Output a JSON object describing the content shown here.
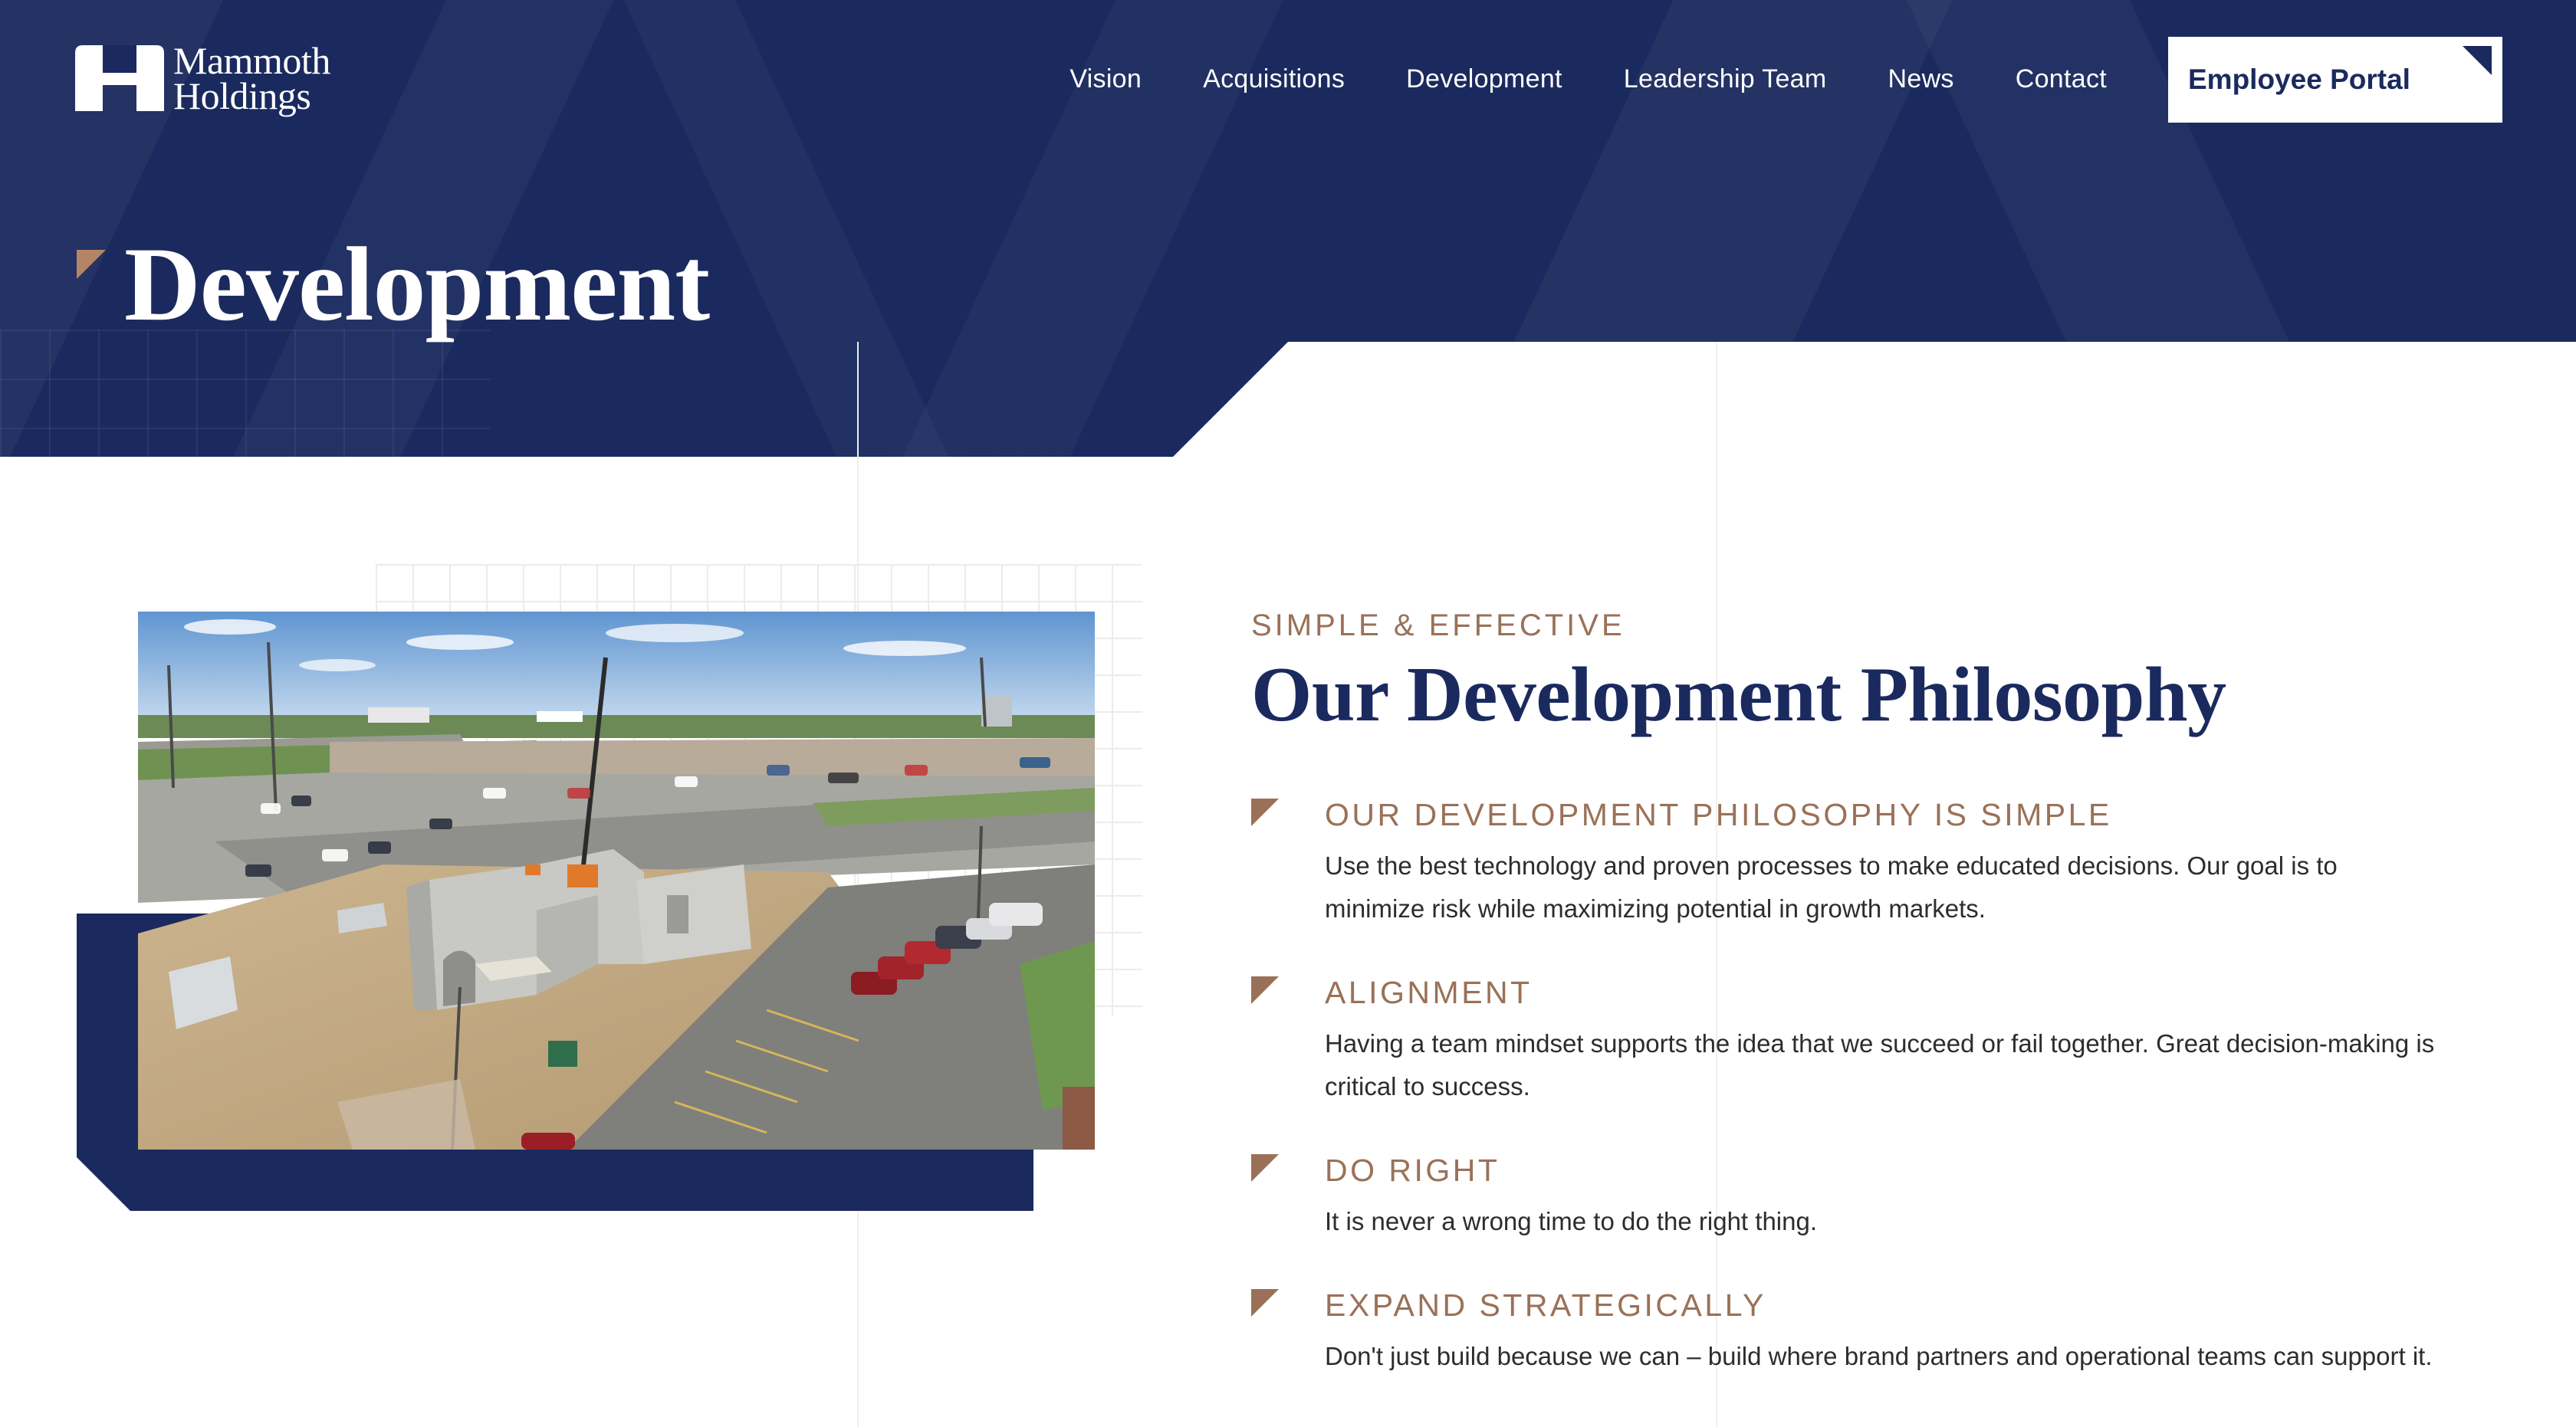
{
  "header": {
    "logo": {
      "line1": "Mammoth",
      "line2": "Holdings",
      "icon": "mammoth-h-logo-icon"
    },
    "nav": [
      "Vision",
      "Acquisitions",
      "Development",
      "Leadership Team",
      "News",
      "Contact"
    ],
    "portal_button": "Employee Portal"
  },
  "hero": {
    "title": "Development"
  },
  "philosophy": {
    "eyebrow": "SIMPLE & EFFECTIVE",
    "title": "Our Development Philosophy",
    "items": [
      {
        "title": "OUR DEVELOPMENT PHILOSOPHY IS SIMPLE",
        "body": "Use the best technology and proven processes to make educated decisions. Our goal is to minimize risk while maximizing potential in growth markets."
      },
      {
        "title": "ALIGNMENT",
        "body": "Having a team mindset supports the idea that we succeed or fail together. Great decision-making is critical to success."
      },
      {
        "title": "DO RIGHT",
        "body": "It is never a wrong time to do the right thing."
      },
      {
        "title": "EXPAND STRATEGICALLY",
        "body": "Don't just build because we can – build where brand partners and operational teams can support it."
      }
    ]
  },
  "colors": {
    "navy": "#1b2a5e",
    "accent_brown": "#9a7158",
    "white": "#ffffff",
    "body_text": "#2d2d2d"
  }
}
